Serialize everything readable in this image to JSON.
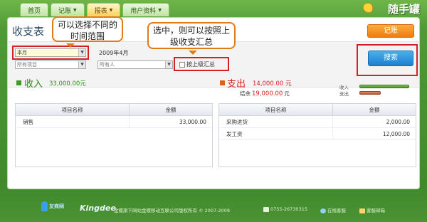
{
  "nav": {
    "tabs": [
      {
        "label": "首页",
        "dropdown": false
      },
      {
        "label": "记账",
        "dropdown": true
      },
      {
        "label": "报表",
        "dropdown": true,
        "active": true
      },
      {
        "label": "用户资料",
        "dropdown": true
      }
    ],
    "logo_text": "随手罐",
    "dropdown_caret": "▼"
  },
  "page": {
    "title": "收支表",
    "record_button": "记账",
    "search_button": "搜索"
  },
  "annotations": {
    "callout_time": "可以选择不同的时间范围",
    "callout_summary": "选中，则可以按照上级收支汇总"
  },
  "filters": {
    "period_value": "本月",
    "month_display": "2009年4月",
    "items_placeholder": "所有项目",
    "payers_placeholder": "所有人",
    "summary_checkbox_label": "按上级汇总",
    "summary_checked": false
  },
  "summary": {
    "income_label": "收入",
    "income_amount": "33,000.00",
    "income_unit": "元",
    "expense_label": "支出",
    "expense_amount": "14,000.00",
    "expense_unit": "元",
    "balance_label": "结余",
    "balance_amount": "19,000.00",
    "balance_unit": "元",
    "chart_income_label": "收入",
    "chart_expense_label": "支出",
    "income_value": 33000,
    "expense_value": 14000,
    "income_color": "#4f8f2f",
    "expense_color": "#b9542a"
  },
  "income_table": {
    "headers": [
      "项目名称",
      "金额"
    ],
    "rows": [
      {
        "name": "销售",
        "amount": "33,000.00"
      }
    ]
  },
  "expense_table": {
    "headers": [
      "项目名称",
      "金额"
    ],
    "rows": [
      {
        "name": "采购进货",
        "amount": "2,000.00"
      },
      {
        "name": "发工资",
        "amount": "12,000.00"
      }
    ]
  },
  "footer": {
    "brand_small": "友商网",
    "brand_kingdee": "Kingdee",
    "copyright": "金蝶旗下网站金蝶移动互联公司版权所有 © 2007-2009",
    "phone": "0755-26730315",
    "online_service": "在线客服",
    "customer_mail": "客服邮箱"
  }
}
